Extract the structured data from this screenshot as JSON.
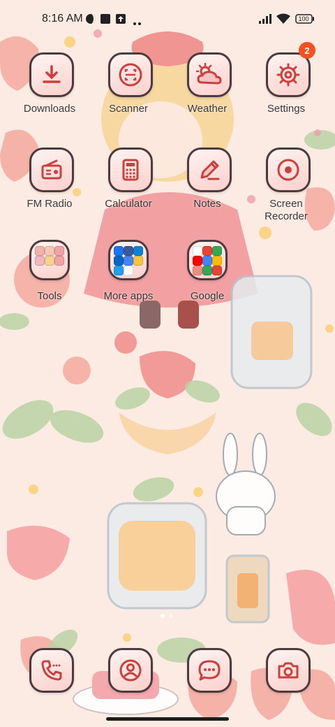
{
  "status_bar": {
    "time": "8:16 AM",
    "battery": "100",
    "left_icons": [
      "dnd-moon-icon",
      "square-app-icon",
      "upload-icon",
      "more-dots-icon"
    ],
    "right_icons": [
      "signal-icon",
      "wifi-icon",
      "battery-icon"
    ]
  },
  "home": {
    "apps": [
      {
        "label": "Downloads",
        "icon": "download-icon"
      },
      {
        "label": "Scanner",
        "icon": "scanner-icon"
      },
      {
        "label": "Weather",
        "icon": "weather-icon"
      },
      {
        "label": "Settings",
        "icon": "gear-icon",
        "badge": "2"
      },
      {
        "label": "FM Radio",
        "icon": "radio-icon"
      },
      {
        "label": "Calculator",
        "icon": "calculator-icon"
      },
      {
        "label": "Notes",
        "icon": "pencil-icon"
      },
      {
        "label": "Screen Recorder",
        "icon": "record-icon"
      }
    ],
    "folders": [
      {
        "label": "Tools"
      },
      {
        "label": "More apps"
      },
      {
        "label": "Google"
      }
    ],
    "page_indicator": {
      "pages": 2,
      "current": 1
    }
  },
  "dock": [
    {
      "name": "Phone",
      "icon": "phone-icon"
    },
    {
      "name": "Contacts",
      "icon": "contacts-icon"
    },
    {
      "name": "Messages",
      "icon": "message-icon"
    },
    {
      "name": "Camera",
      "icon": "camera-icon"
    }
  ],
  "colors": {
    "wallpaper_bg": "#fcebe2",
    "icon_outline": "#4d3a3e",
    "icon_fill": "#fbd0cc",
    "glyph": "#c9403f",
    "badge": "#f4511e"
  }
}
